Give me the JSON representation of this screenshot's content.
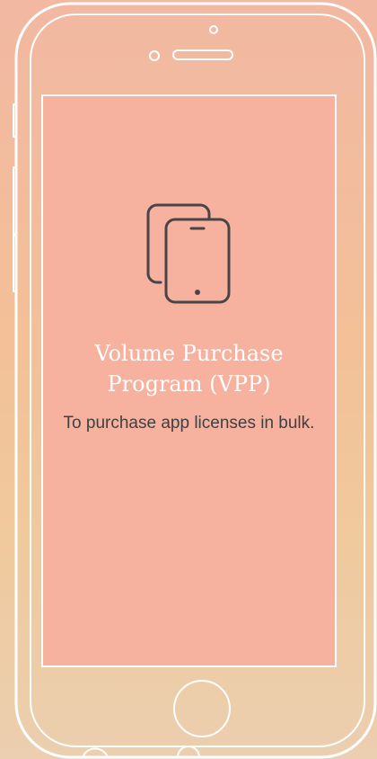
{
  "card": {
    "icon": "devices-icon",
    "title": "Volume Purchase Program (VPP)",
    "description": "To purchase app licenses in bulk."
  },
  "colors": {
    "screen": "#f6b29e",
    "outline": "#ffffff",
    "icon_stroke": "#4a4448",
    "description_text": "#404040"
  }
}
